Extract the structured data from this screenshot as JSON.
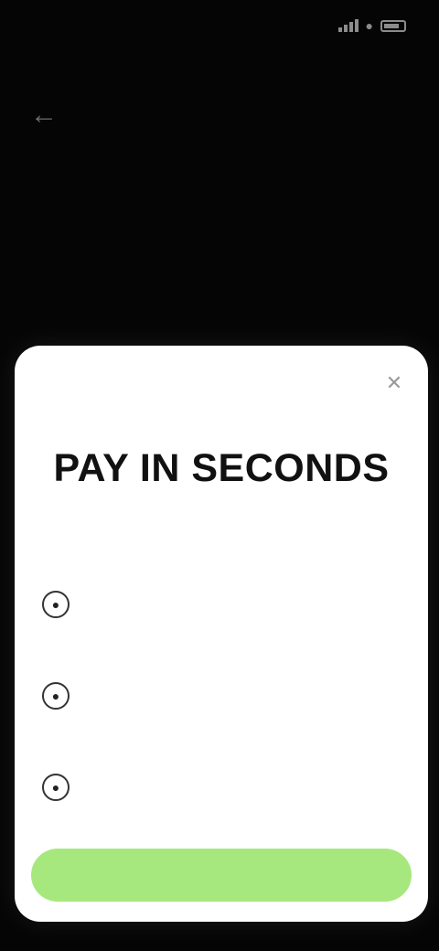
{
  "status_bar": {
    "time": "",
    "icons": [
      "signal-icon",
      "wifi-icon",
      "battery-icon"
    ]
  },
  "background": {
    "back_icon": "back-arrow-icon",
    "heading": "",
    "caption": ""
  },
  "sheet": {
    "title": "PAY IN SECONDS",
    "subtitle": "",
    "close_icon": "close-icon",
    "steps": [
      {
        "icon": "step-one-icon",
        "title": "",
        "description": ""
      },
      {
        "icon": "step-two-icon",
        "title": "",
        "description": ""
      },
      {
        "icon": "step-three-icon",
        "title": "",
        "description": ""
      }
    ],
    "cta_label": ""
  },
  "colors": {
    "accent": "#a7e87e",
    "sheet_background": "#ffffff",
    "page_background": "#050505"
  }
}
